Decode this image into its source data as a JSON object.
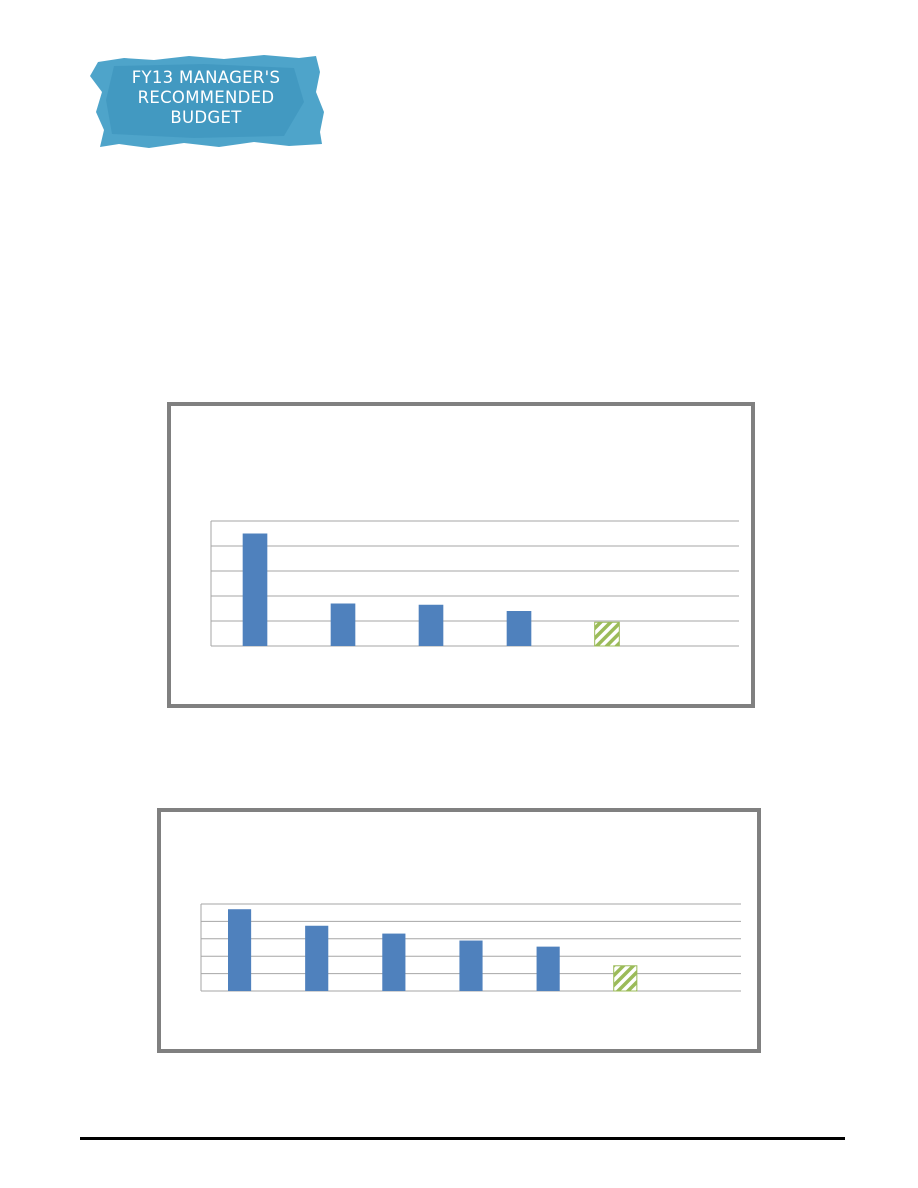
{
  "logo": {
    "lines": [
      "FY13 MANAGER'S",
      "RECOMMENDED",
      "BUDGET"
    ],
    "color": "#3b9ac4"
  },
  "colors": {
    "bar": "#4f81bd",
    "highlight": "#9bbb59",
    "grid": "#a6a6a6",
    "frame": "#808080"
  },
  "chart_data": [
    {
      "type": "bar",
      "categories": [
        "",
        "",
        "",
        "",
        "",
        ""
      ],
      "values": [
        4.5,
        1.7,
        1.65,
        1.4,
        0.95,
        0
      ],
      "highlight_index": 4,
      "ylim": [
        0,
        5
      ],
      "grid": true
    },
    {
      "type": "bar",
      "categories": [
        "",
        "",
        "",
        "",
        "",
        "",
        ""
      ],
      "values": [
        4.7,
        3.75,
        3.3,
        2.9,
        2.55,
        1.45,
        0
      ],
      "highlight_index": 5,
      "ylim": [
        0,
        5
      ],
      "grid": true
    }
  ]
}
